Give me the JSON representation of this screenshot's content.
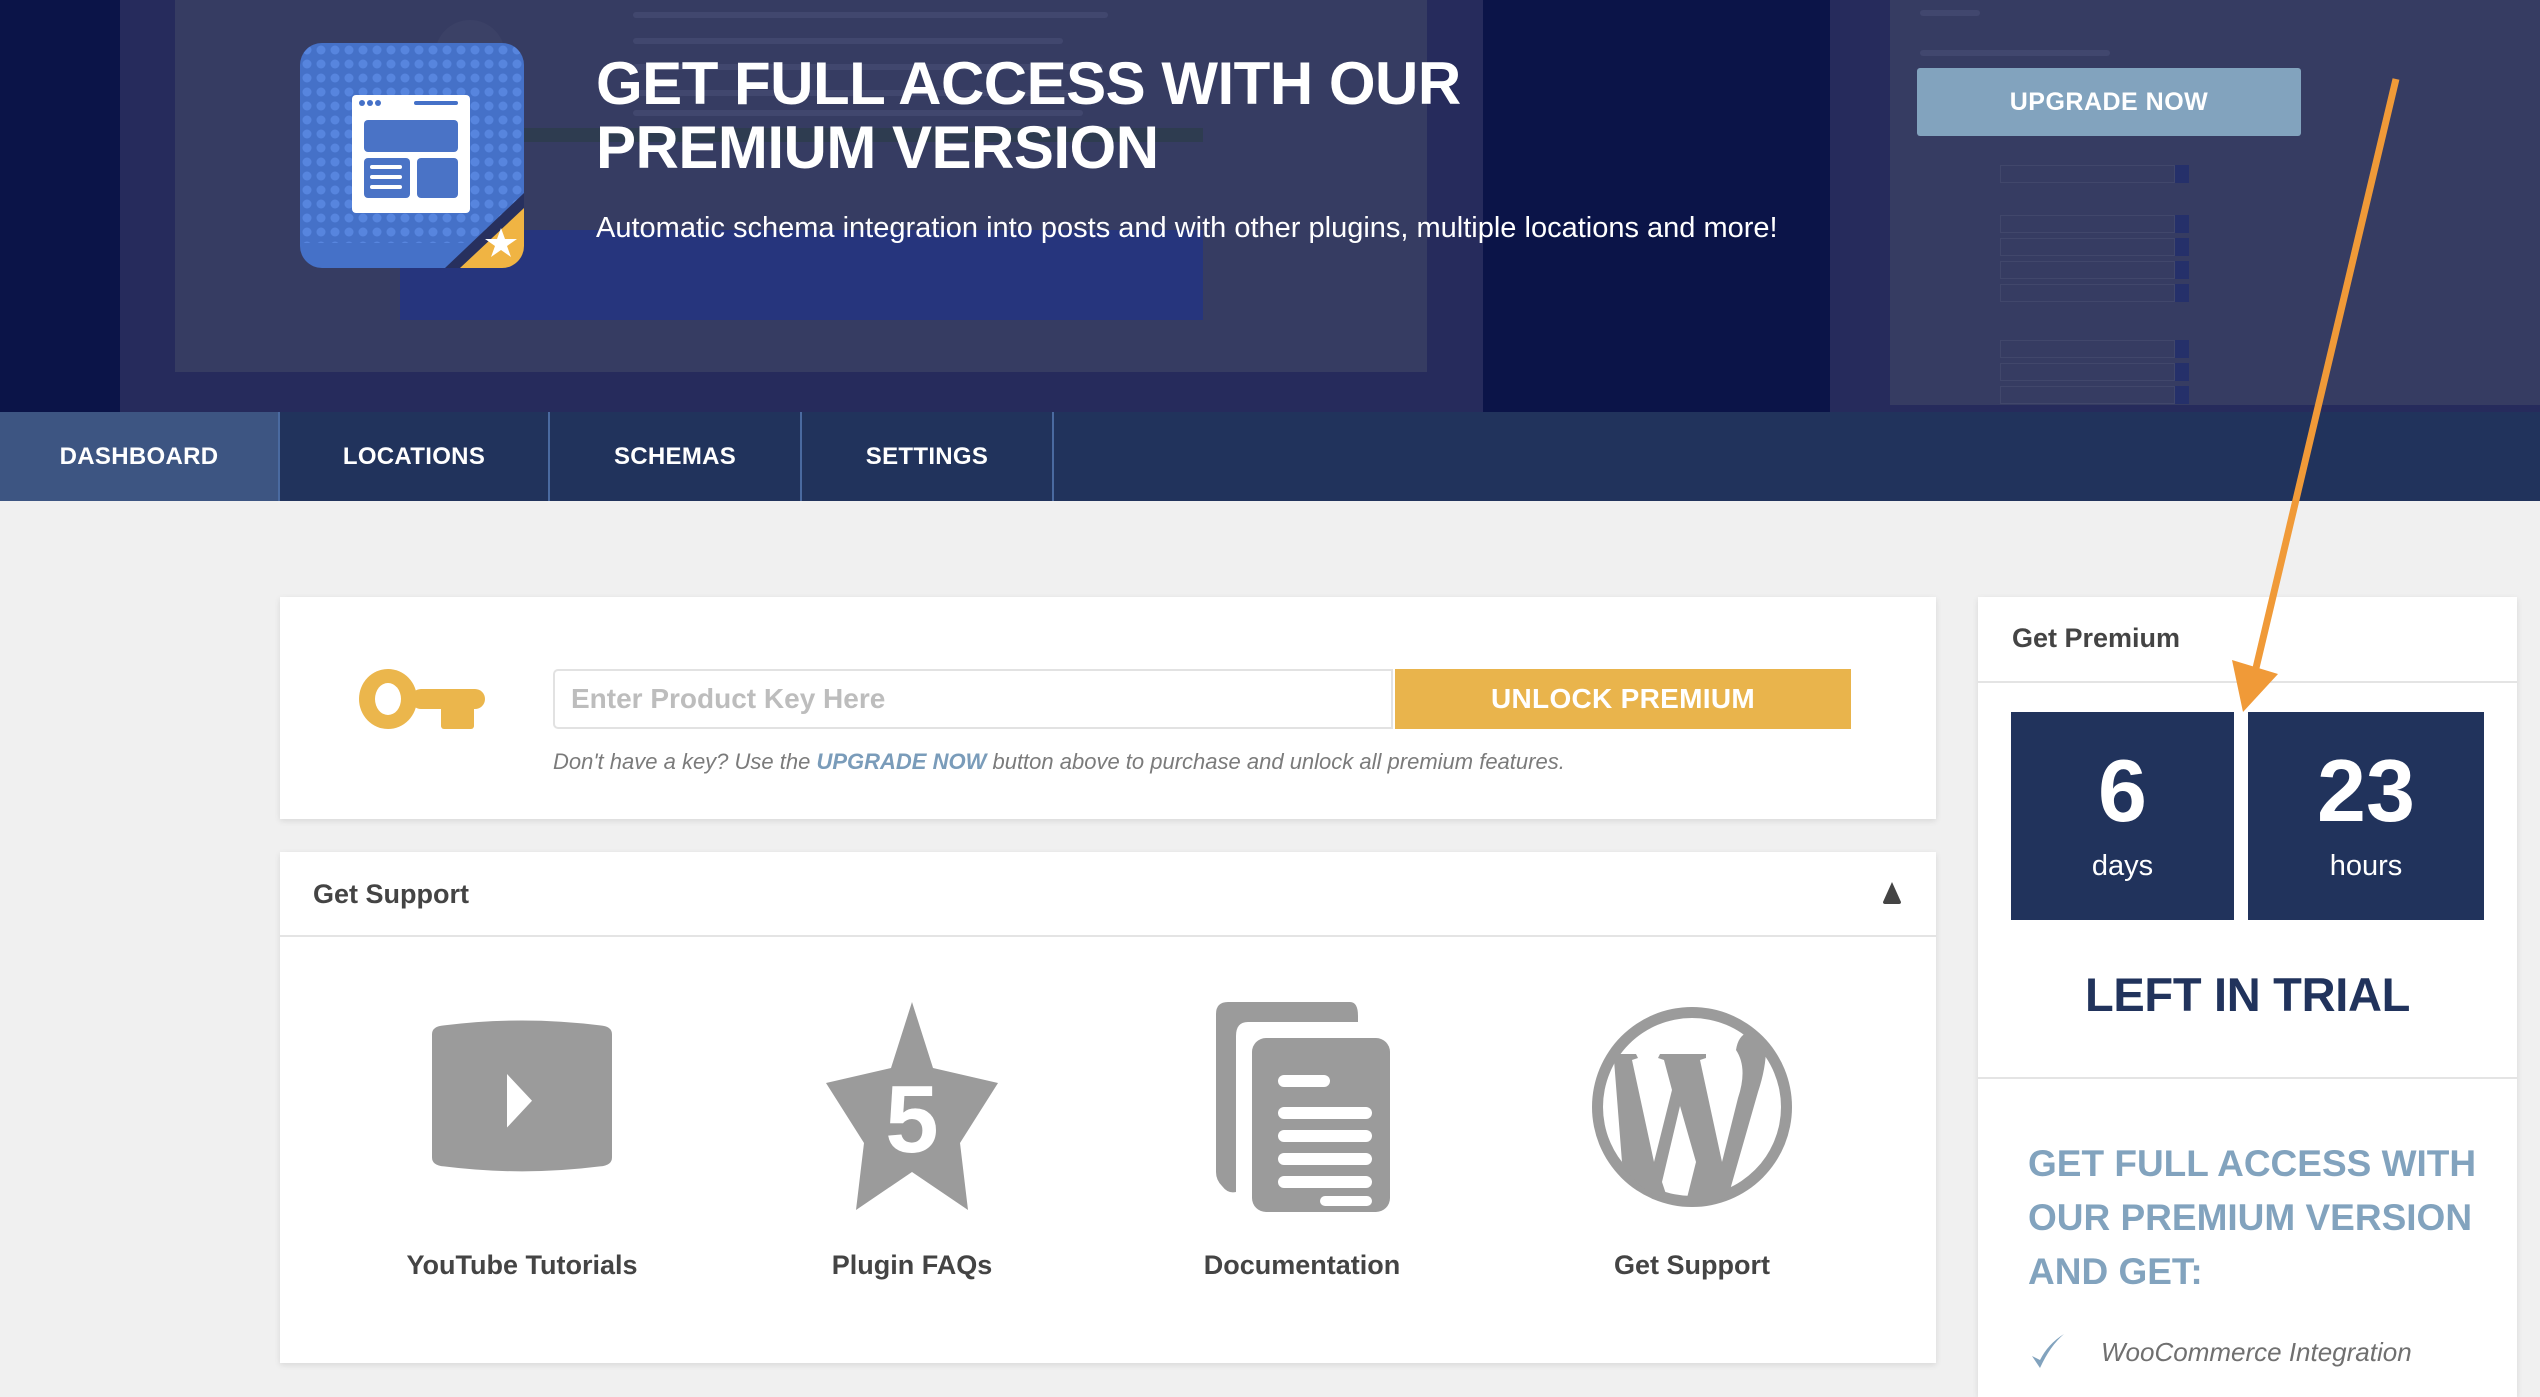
{
  "hero": {
    "title": "GET FULL ACCESS WITH OUR PREMIUM VERSION",
    "subtitle": "Automatic schema integration into posts and with other plugins, multiple locations and more!",
    "upgrade_button": "UPGRADE NOW",
    "logo_icon": "schema-premium-logo-icon"
  },
  "nav": {
    "tabs": [
      {
        "label": "DASHBOARD",
        "active": true
      },
      {
        "label": "LOCATIONS",
        "active": false
      },
      {
        "label": "SCHEMAS",
        "active": false
      },
      {
        "label": "SETTINGS",
        "active": false
      }
    ]
  },
  "unlock": {
    "key_icon": "key-icon",
    "input_value": "",
    "input_placeholder": "Enter Product Key Here",
    "button_label": "UNLOCK PREMIUM",
    "help_prefix": "Don't have a key? Use the ",
    "help_link": "UPGRADE NOW",
    "help_suffix": " button above to purchase and unlock all premium features."
  },
  "support": {
    "title": "Get Support",
    "toggle_icon": "caret-up-icon",
    "items": [
      {
        "label": "YouTube Tutorials",
        "icon": "video-play-icon"
      },
      {
        "label": "Plugin FAQs",
        "icon": "star-five-icon"
      },
      {
        "label": "Documentation",
        "icon": "documents-icon"
      },
      {
        "label": "Get Support",
        "icon": "wordpress-icon"
      }
    ]
  },
  "premium": {
    "title": "Get Premium",
    "countdown": [
      {
        "value": "6",
        "unit": "days"
      },
      {
        "value": "23",
        "unit": "hours"
      }
    ],
    "trial_label": "LEFT IN TRIAL",
    "pitch": "GET FULL ACCESS WITH OUR PREMIUM VERSION AND GET:",
    "features": [
      {
        "icon": "checkmark-icon",
        "label": "WooCommerce Integration"
      }
    ]
  },
  "colors": {
    "navy": "#21335c",
    "active_tab": "#3d5582",
    "gold": "#e9b44c",
    "steel_blue": "#82a3be",
    "annotation_orange": "#f09a38"
  }
}
